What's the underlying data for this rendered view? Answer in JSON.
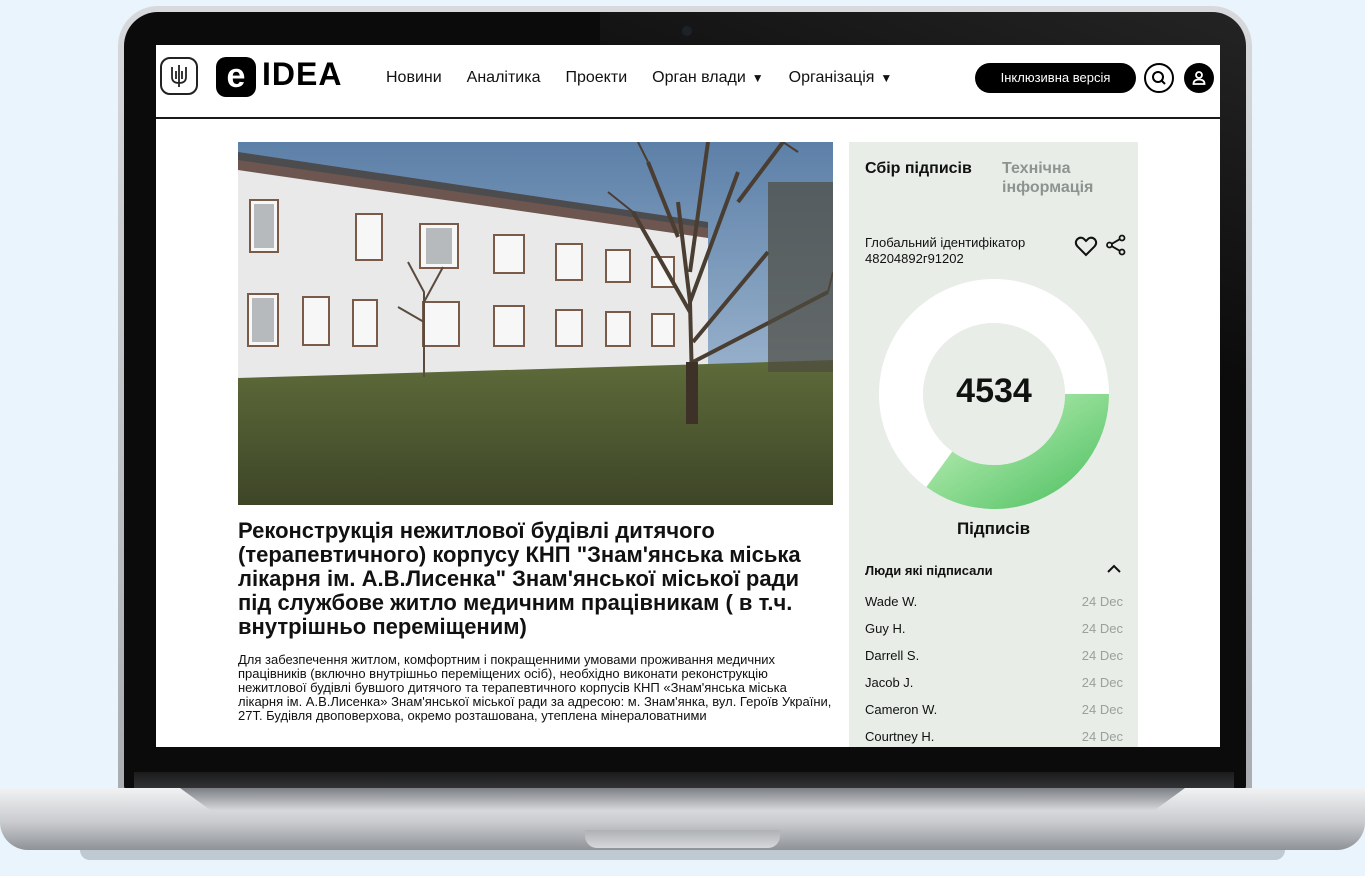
{
  "header": {
    "logo_mark": "e",
    "logo_text": "IDEA",
    "nav": [
      {
        "label": "Новини",
        "dropdown": false
      },
      {
        "label": "Аналітика",
        "dropdown": false
      },
      {
        "label": "Проекти",
        "dropdown": false
      },
      {
        "label": "Орган влади",
        "dropdown": true
      },
      {
        "label": "Організація",
        "dropdown": true
      }
    ],
    "inclusive_button": "Інклюзивна версія"
  },
  "article": {
    "title": "Реконструкція нежитлової будівлі дитячого (терапевтичного) корпусу КНП \"Знам'янська міська лікарня ім. А.В.Лисенка\" Знам'янської міської ради під службове житло медичним працівникам ( в т.ч. внутрішньо переміщеним)",
    "body": "Для забезпечення житлом, комфортним і покращенними умовами проживання медичних працівників (включно внутрішньо переміщених осіб), необхідно виконати реконструкцію нежитлової будівлі бувшого дитячого та терапевтичного корпусів КНП «Знам'янська міська лікарня ім. А.В.Лисенка» Знам'янської міської ради за адресою: м. Знам'янка, вул. Героїв України, 27Т. Будівля двоповерхова, окремо розташована, утеплена мінераловатними"
  },
  "panel": {
    "tab_active": "Сбір підписів",
    "tab_inactive": "Технічна інформація",
    "global_id_label": "Глобальний ідентифікатор",
    "global_id_value": "48204892г91202",
    "signature_count": "4534",
    "signatures_label": "Підписів",
    "signed_progress_fraction": 0.35,
    "people_title": "Люди які підписали",
    "people": [
      {
        "name": "Wade W.",
        "date": "24 Dec"
      },
      {
        "name": "Guy H.",
        "date": "24 Dec"
      },
      {
        "name": "Darrell S.",
        "date": "24 Dec"
      },
      {
        "name": "Jacob J.",
        "date": "24 Dec"
      },
      {
        "name": "Cameron W.",
        "date": "24 Dec"
      },
      {
        "name": "Courtney H.",
        "date": "24 Dec"
      }
    ]
  },
  "colors": {
    "panel_bg": "#e8ede8",
    "progress_green": "#6fcf7c",
    "accent_black": "#000000"
  }
}
